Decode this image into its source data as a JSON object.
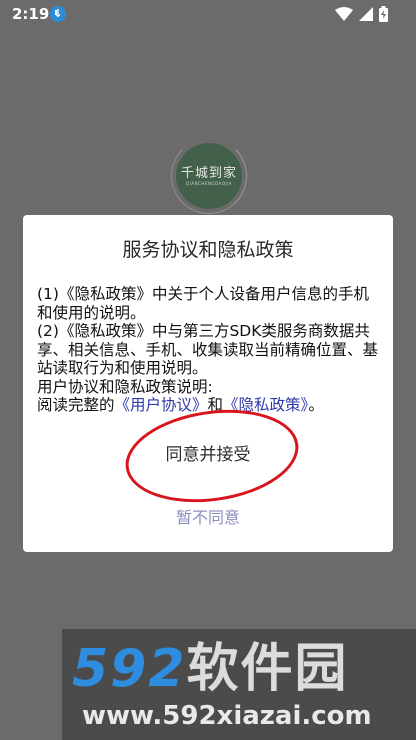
{
  "status_bar": {
    "time": "2:19"
  },
  "splash": {
    "logo_text": "千城到家",
    "logo_subtext": "QIANCHENGDAOJIA"
  },
  "dialog": {
    "title": "服务协议和隐私政策",
    "paragraph1": "(1)《隐私政策》中关于个人设备用户信息的手机和使用的说明。",
    "paragraph2": "(2)《隐私政策》中与第三方SDK类服务商数据共享、相关信息、手机、收集读取当前精确位置、基站读取行为和使用说明。",
    "paragraph3": "用户协议和隐私政策说明:",
    "read_prefix": "阅读完整的",
    "link_user_agreement": "《用户协议》",
    "and_text": "和",
    "link_privacy_policy": "《隐私政策》",
    "read_suffix": "。",
    "agree_label": "同意并接受",
    "decline_label": "暂不同意"
  },
  "watermark": {
    "digits": "592",
    "brand": "软件园",
    "url": "www.592xiazai.com"
  },
  "colors": {
    "link": "#2e3aa8",
    "annotation": "#d8141c",
    "watermark_blue": "#2f8ddf"
  }
}
